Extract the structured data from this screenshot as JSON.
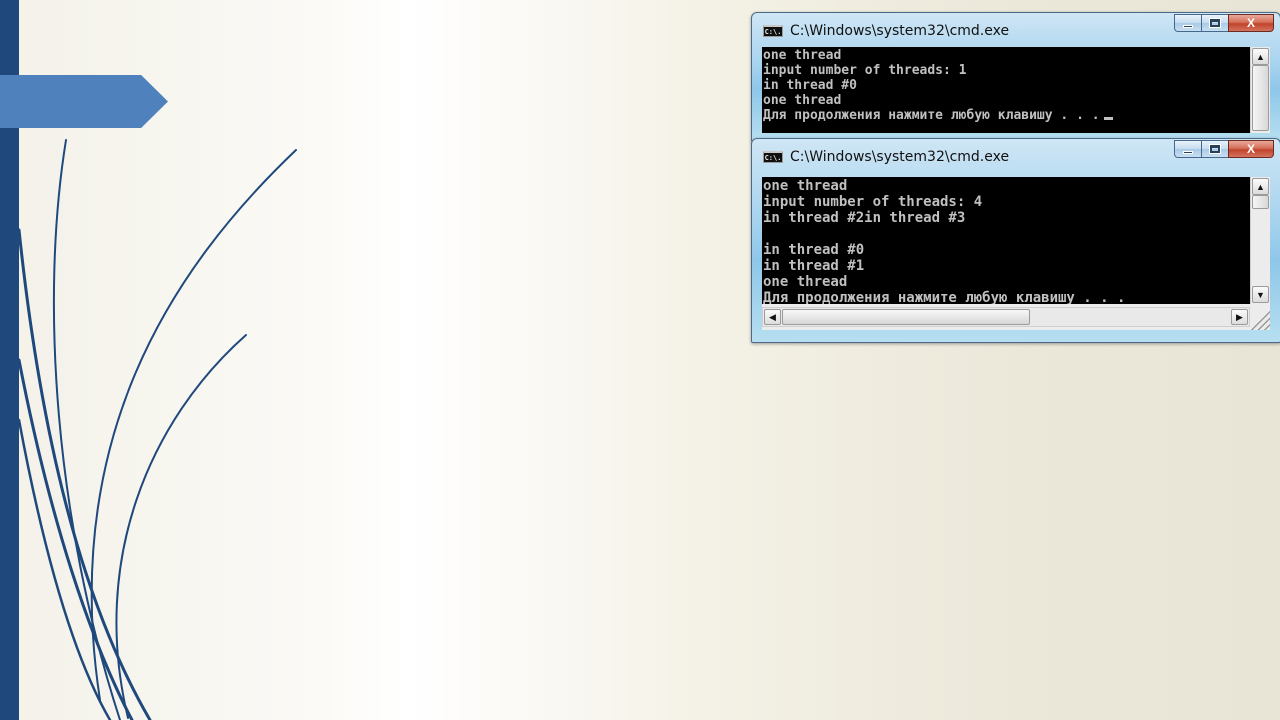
{
  "colors": {
    "sidebar_bar": "#1f497d",
    "arrow_shape": "#4f81bd",
    "swoosh_lines": "#1f497d",
    "console_background": "#000000",
    "console_text": "#c0c0c0",
    "close_button": "#c2432a"
  },
  "windows": [
    {
      "title": "C:\\Windows\\system32\\cmd.exe",
      "icon": "cmd-icon",
      "icon_text": "C:\\.",
      "lines": [
        "one thread",
        "input number of threads: 1",
        "in thread #0",
        "one thread",
        "Для продолжения нажмите любую клавишу . . ."
      ]
    },
    {
      "title": "C:\\Windows\\system32\\cmd.exe",
      "icon": "cmd-icon",
      "icon_text": "C:\\.",
      "lines": [
        "one thread",
        "input number of threads: 4",
        "in thread #2in thread #3",
        "",
        "in thread #0",
        "in thread #1",
        "one thread",
        "Для продолжения нажмите любую клавишу . . ."
      ]
    }
  ],
  "window_controls": {
    "minimize": "minimize-icon",
    "maximize": "maximize-icon",
    "close": "close-icon",
    "close_glyph": "X"
  },
  "scrollbar_glyphs": {
    "up": "▲",
    "down": "▼",
    "left": "◀",
    "right": "▶"
  }
}
